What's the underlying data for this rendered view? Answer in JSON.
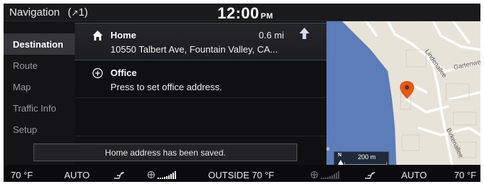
{
  "statusbar": {
    "title": "Navigation",
    "signal": "( 1)",
    "time": "12:00",
    "ampm": "PM"
  },
  "sidebar": {
    "items": [
      {
        "label": "Destination",
        "active": true
      },
      {
        "label": "Route",
        "active": false
      },
      {
        "label": "Map",
        "active": false
      },
      {
        "label": "Traffic Info",
        "active": false
      },
      {
        "label": "Setup",
        "active": false
      }
    ]
  },
  "list": {
    "home": {
      "title": "Home",
      "address": "10550 Talbert Ave, Fountain Valley, CA...",
      "distance": "0.6 mi"
    },
    "office": {
      "title": "Office",
      "subtitle": "Press to set office address."
    }
  },
  "map": {
    "streets": [
      "Lindenallee",
      "Gartenwe",
      "Birkenallee"
    ],
    "scale": "200 m",
    "north_label": "N",
    "partial_label": "e"
  },
  "toast": {
    "message": "Home address has been saved."
  },
  "climate": {
    "left_temp": "70 °F",
    "left_mode": "AUTO",
    "outside": "OUTSIDE  70 °F",
    "right_mode": "AUTO",
    "right_temp": "70 °F"
  },
  "colors": {
    "background": "#0b0b0d",
    "active_tab": "#35353a",
    "water": "#5d7dba",
    "land": "#e7e3d8",
    "pin": "#e05a1c"
  }
}
